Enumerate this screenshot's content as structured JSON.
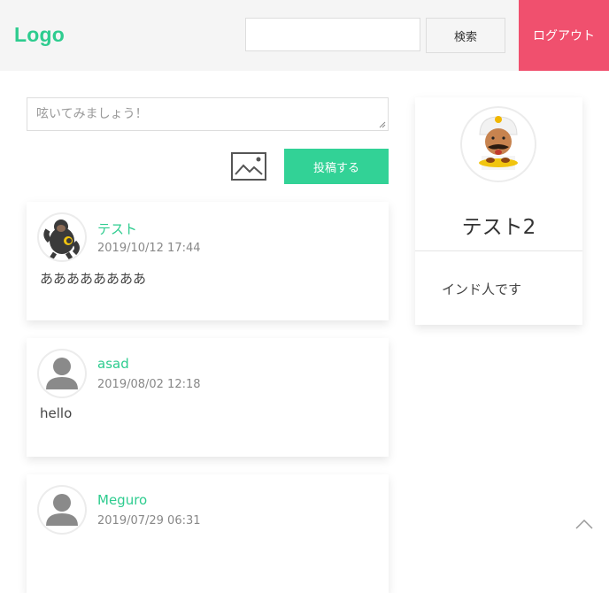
{
  "header": {
    "logo": "Logo",
    "search_button": "検索",
    "logout_button": "ログアウト"
  },
  "composer": {
    "placeholder": "呟いてみましょう！",
    "post_button": "投稿する"
  },
  "posts": [
    {
      "name": "テスト",
      "date": "2019/10/12 17:44",
      "body": "ああああああああ",
      "avatar": "gorilla-avatar"
    },
    {
      "name": "asad",
      "date": "2019/08/02 12:18",
      "body": "hello",
      "avatar": "default-user-avatar"
    },
    {
      "name": "Meguro",
      "date": "2019/07/29 06:31",
      "body": "",
      "avatar": "default-user-avatar"
    }
  ],
  "profile": {
    "name": "テスト2",
    "bio": "インド人です",
    "avatar": "indian-chef-avatar"
  },
  "colors": {
    "accent": "#2ecc8f",
    "post_button": "#32d296",
    "logout": "#f0506e",
    "header_bg": "#f5f5f5"
  }
}
